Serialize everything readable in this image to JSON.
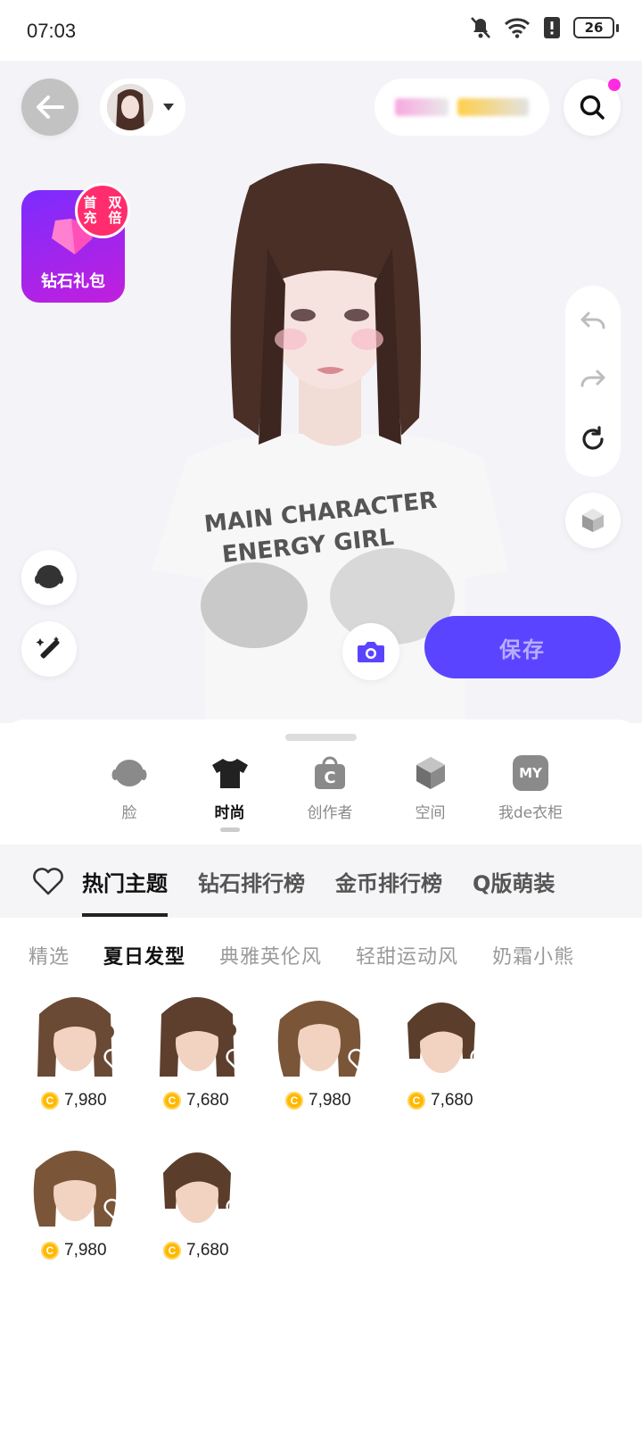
{
  "status_bar": {
    "time": "07:03",
    "battery": "26"
  },
  "header": {
    "back_label": "",
    "search_label": ""
  },
  "gift": {
    "badge": "首充\n双倍",
    "badge_line1": "首充",
    "badge_line2": "双倍",
    "label": "钻石礼包"
  },
  "stage": {
    "save_label": "保存",
    "shirt_text_line1": "MAIN CHARACTER",
    "shirt_text_line2": "ENERGY GIRL"
  },
  "categories": [
    {
      "label": "脸",
      "icon": "face-icon"
    },
    {
      "label": "时尚",
      "icon": "tshirt-icon",
      "active": true
    },
    {
      "label": "创作者",
      "icon": "creator-bag-icon"
    },
    {
      "label": "空间",
      "icon": "cube-icon"
    },
    {
      "label": "我de衣柜",
      "icon": "my-wardrobe-icon",
      "icon_text": "MY"
    }
  ],
  "themes": [
    {
      "label": "热门主题",
      "active": true
    },
    {
      "label": "钻石排行榜"
    },
    {
      "label": "金币排行榜"
    },
    {
      "label": "Q版萌装"
    }
  ],
  "subcategories": [
    {
      "label": "精选"
    },
    {
      "label": "夏日发型",
      "active": true
    },
    {
      "label": "典雅英伦风"
    },
    {
      "label": "轻甜运动风"
    },
    {
      "label": "奶霜小熊"
    }
  ],
  "items": [
    {
      "price": "7,980"
    },
    {
      "price": "7,680"
    },
    {
      "price": "7,980"
    },
    {
      "price": "7,680"
    },
    {
      "price": "7,980"
    },
    {
      "price": "7,680"
    }
  ],
  "colors": {
    "accent": "#5b44ff",
    "badge": "#ff2d6e",
    "coin": "#ffb800",
    "notify_dot": "#ff2be0"
  }
}
